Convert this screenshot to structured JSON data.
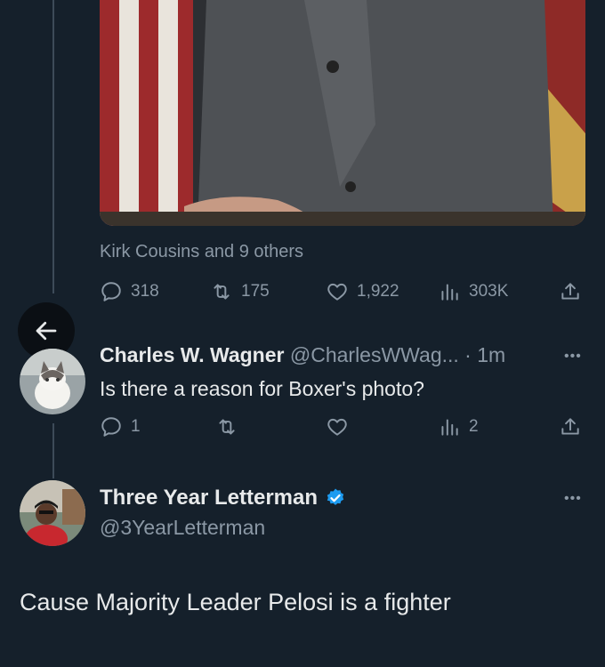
{
  "previous_tweet": {
    "liked_by_text": "Kirk Cousins and 9 others",
    "actions": {
      "replies": "318",
      "retweets": "175",
      "likes": "1,922",
      "views": "303K"
    }
  },
  "reply": {
    "display_name": "Charles W. Wagner",
    "handle_time": "@CharlesWWag... · 1m",
    "text": "Is there a reason for Boxer's photo?",
    "actions": {
      "replies": "1",
      "views": "2"
    }
  },
  "main_tweet": {
    "display_name": "Three Year Letterman",
    "handle": "@3YearLetterman",
    "text": "Cause Majority Leader Pelosi is a fighter",
    "verified_color": "#1d9bf0"
  },
  "colors": {
    "background": "#15202b",
    "text": "#e7e9ea",
    "muted": "#8b98a5",
    "accent": "#1d9bf0"
  }
}
